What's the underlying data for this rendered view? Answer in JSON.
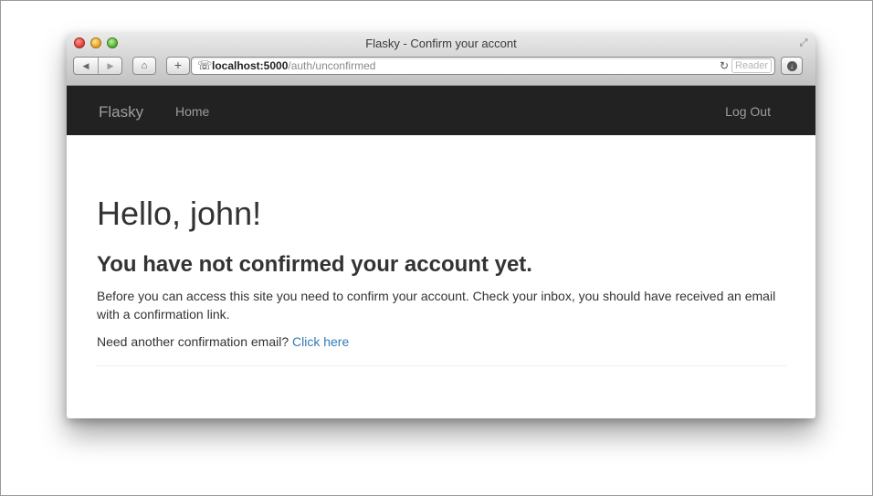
{
  "browser": {
    "window_title": "Flasky - Confirm your accont",
    "url_host": "localhost:5000",
    "url_path": "/auth/unconfirmed",
    "reader_label": "Reader"
  },
  "navbar": {
    "brand": "Flasky",
    "home_label": "Home",
    "logout_label": "Log Out"
  },
  "main": {
    "greeting": "Hello, john!",
    "heading": "You have not confirmed your account yet.",
    "message": "Before you can access this site you need to confirm your account. Check your inbox, you should have received an email with a confirmation link.",
    "resend_prompt": "Need another confirmation email? ",
    "resend_link": "Click here"
  },
  "colors": {
    "navbar_bg": "#222222",
    "navbar_text": "#9d9d9d",
    "link": "#337ab7"
  }
}
